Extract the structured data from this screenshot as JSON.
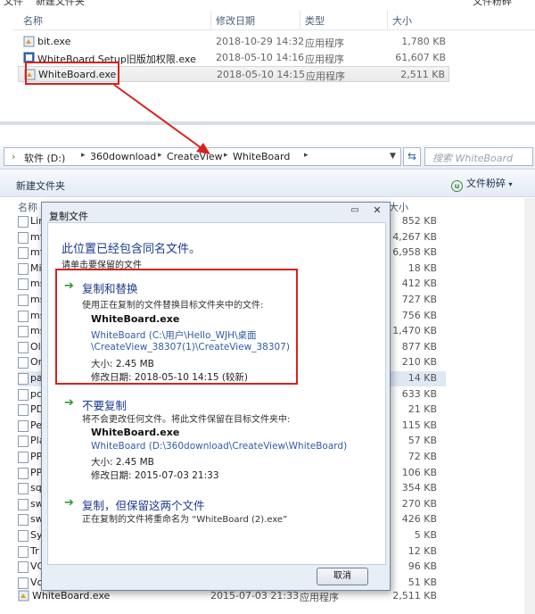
{
  "top_window": {
    "clipped_labels": [
      "文件",
      "新建文件夹",
      "文件粉碎"
    ],
    "columns": {
      "name": "名称",
      "modified": "修改日期",
      "type": "类型",
      "size": "大小"
    },
    "files": [
      {
        "name": "bit.exe",
        "modified": "2018-10-29 14:32",
        "type": "应用程序",
        "size": "1,780 KB",
        "selected": false
      },
      {
        "name": "WhiteBoard Setup旧版加权限.exe",
        "modified": "2018-05-10 14:16",
        "type": "应用程序",
        "size": "61,607 KB",
        "selected": false
      },
      {
        "name": "WhiteBoard.exe",
        "modified": "2018-05-10 14:15",
        "type": "应用程序",
        "size": "2,511 KB",
        "selected": true
      }
    ]
  },
  "bottom_window": {
    "breadcrumbs": [
      "软件 (D:)",
      "360download",
      "CreateView",
      "WhiteBoard"
    ],
    "search_placeholder": "搜索 WhiteBoard",
    "toolbar": {
      "new_folder": "新建文件夹",
      "rootkit_icon": "u",
      "rootkit_label": "文件粉碎"
    },
    "columns": {
      "name": "名称",
      "size": "大小"
    },
    "rows": [
      {
        "name": "Lin",
        "size": "852 KB"
      },
      {
        "name": "mf",
        "size": "4,267 KB"
      },
      {
        "name": "mf",
        "size": "6,958 KB"
      },
      {
        "name": "Mi",
        "size": "18 KB"
      },
      {
        "name": "ms",
        "size": "412 KB"
      },
      {
        "name": "ms",
        "size": "727 KB"
      },
      {
        "name": "ms",
        "size": "756 KB"
      },
      {
        "name": "ms",
        "size": "1,470 KB"
      },
      {
        "name": "Ol",
        "size": "877 KB"
      },
      {
        "name": "Or",
        "size": "210 KB"
      },
      {
        "name": "pa",
        "size": "14 KB"
      },
      {
        "name": "pc",
        "size": "633 KB"
      },
      {
        "name": "PD",
        "size": "21 KB"
      },
      {
        "name": "Pe",
        "size": "115 KB"
      },
      {
        "name": "Pla",
        "size": "57 KB"
      },
      {
        "name": "PP",
        "size": "72 KB"
      },
      {
        "name": "PP",
        "size": "106 KB"
      },
      {
        "name": "sq",
        "size": "354 KB"
      },
      {
        "name": "sw",
        "size": "270 KB"
      },
      {
        "name": "sw",
        "size": "426 KB"
      },
      {
        "name": "Sy",
        "size": "5 KB"
      },
      {
        "name": "Tr",
        "size": "12 KB"
      },
      {
        "name": "VC",
        "size": "96 KB"
      },
      {
        "name": "Vc",
        "size": "51 KB"
      }
    ],
    "last_row": {
      "name": "WhiteBoard.exe",
      "modified": "2015-07-03 21:33",
      "type": "应用程序",
      "size": "2,511 KB"
    }
  },
  "dialog": {
    "title": "复制文件",
    "heading": "此位置已经包含同名文件。",
    "subheading": "请单击要保留的文件",
    "options": [
      {
        "title": "复制和替换",
        "description": "使用正在复制的文件替换目标文件夹中的文件:",
        "file_name": "WhiteBoard.exe",
        "path_line1": "WhiteBoard (C:\\用户\\Hello_WJH\\桌面",
        "path_line2": "\\CreateView_38307(1)\\CreateView_38307)",
        "size": "大小: 2.45 MB",
        "modified": "修改日期: 2018-05-10 14:15 (较新)"
      },
      {
        "title": "不要复制",
        "description": "将不会更改任何文件。将此文件保留在目标文件夹中:",
        "file_name": "WhiteBoard.exe",
        "path_line1": "WhiteBoard (D:\\360download\\CreateView\\WhiteBoard)",
        "size": "大小: 2.45 MB",
        "modified": "修改日期: 2015-07-03 21:33"
      },
      {
        "title": "复制，但保留这两个文件",
        "description": "正在复制的文件将重命名为 “WhiteBoard (2).exe”"
      }
    ],
    "cancel_label": "取消"
  },
  "annotation_color": "#d8211f"
}
